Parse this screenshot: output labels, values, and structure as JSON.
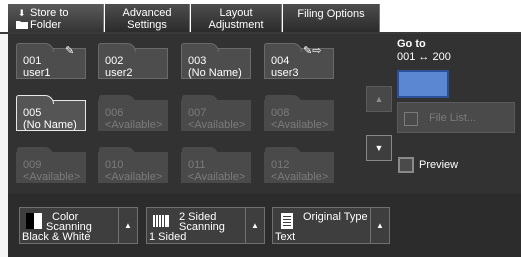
{
  "tabs": [
    {
      "id": "store",
      "line1": "Store to",
      "line2": "Folder"
    },
    {
      "id": "adv",
      "line1": "Advanced",
      "line2": "Settings"
    },
    {
      "id": "layout",
      "line1": "Layout",
      "line2": "Adjustment"
    },
    {
      "id": "filing",
      "line1": "Filing Options",
      "line2": ""
    }
  ],
  "folders": [
    {
      "num": "001",
      "name": "user1"
    },
    {
      "num": "002",
      "name": "user2"
    },
    {
      "num": "003",
      "name": "(No Name)"
    },
    {
      "num": "004",
      "name": "user3"
    },
    {
      "num": "005",
      "name": "(No Name)"
    },
    {
      "num": "006",
      "name": "<Available>"
    },
    {
      "num": "007",
      "name": "<Available>"
    },
    {
      "num": "008",
      "name": "<Available>"
    },
    {
      "num": "009",
      "name": "<Available>"
    },
    {
      "num": "010",
      "name": "<Available>"
    },
    {
      "num": "011",
      "name": "<Available>"
    },
    {
      "num": "012",
      "name": "<Available>"
    }
  ],
  "goto": {
    "label": "Go to",
    "range": "001 ↔ 200"
  },
  "file_list": {
    "label": "File List..."
  },
  "preview": {
    "label": "Preview"
  },
  "options": {
    "color": {
      "title1": "Color",
      "title2": "Scanning",
      "value": "Black & White"
    },
    "sided": {
      "title1": "2 Sided",
      "title2": "Scanning",
      "value": "1 Sided"
    },
    "original": {
      "title1": "Original Type",
      "value": "Text"
    }
  },
  "icons": {
    "store_tab": "folder-icon",
    "scroll_up": "triangle-up-icon",
    "scroll_down": "triangle-down-icon"
  }
}
